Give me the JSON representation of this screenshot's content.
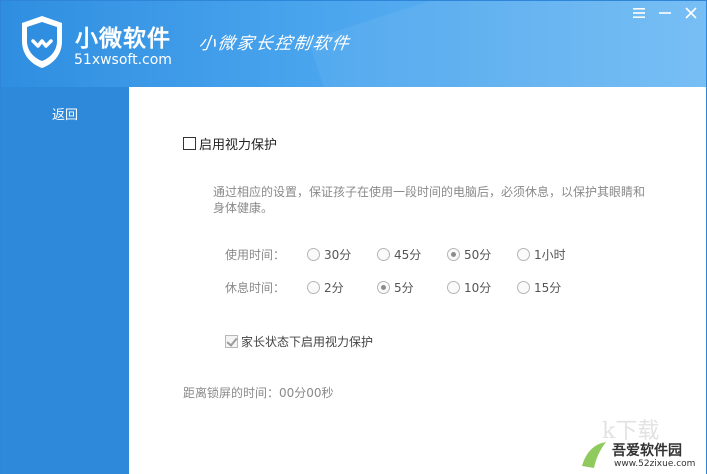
{
  "header": {
    "brand_name": "小微软件",
    "brand_url": "51xwsoft.com",
    "slogan": "小微家长控制软件"
  },
  "window_controls": {
    "menu": "menu-icon",
    "minimize": "minimize-icon",
    "close": "close-icon"
  },
  "sidebar": {
    "back_label": "返回"
  },
  "main": {
    "eye_protection_label": "启用视力保护",
    "eye_protection_checked": false,
    "description": "通过相应的设置，保证孩子在使用一段时间的电脑后，必须休息，以保护其眼睛和身体健康。",
    "use_time": {
      "label": "使用时间：",
      "options": [
        "30分",
        "45分",
        "50分",
        "1小时"
      ],
      "selected": "50分"
    },
    "rest_time": {
      "label": "休息时间：",
      "options": [
        "2分",
        "5分",
        "10分",
        "15分"
      ],
      "selected": "5分"
    },
    "parent_mode_label": "家长状态下启用视力保护",
    "parent_mode_checked": true,
    "lock_countdown_label": "距离锁屏的时间：",
    "lock_countdown_value": "00分00秒"
  },
  "watermark": {
    "title": "吾爱软件园",
    "url": "www.52zixue.com"
  },
  "colors": {
    "header_blue": "#2f8ee0",
    "sidebar_blue": "#2e89db"
  }
}
